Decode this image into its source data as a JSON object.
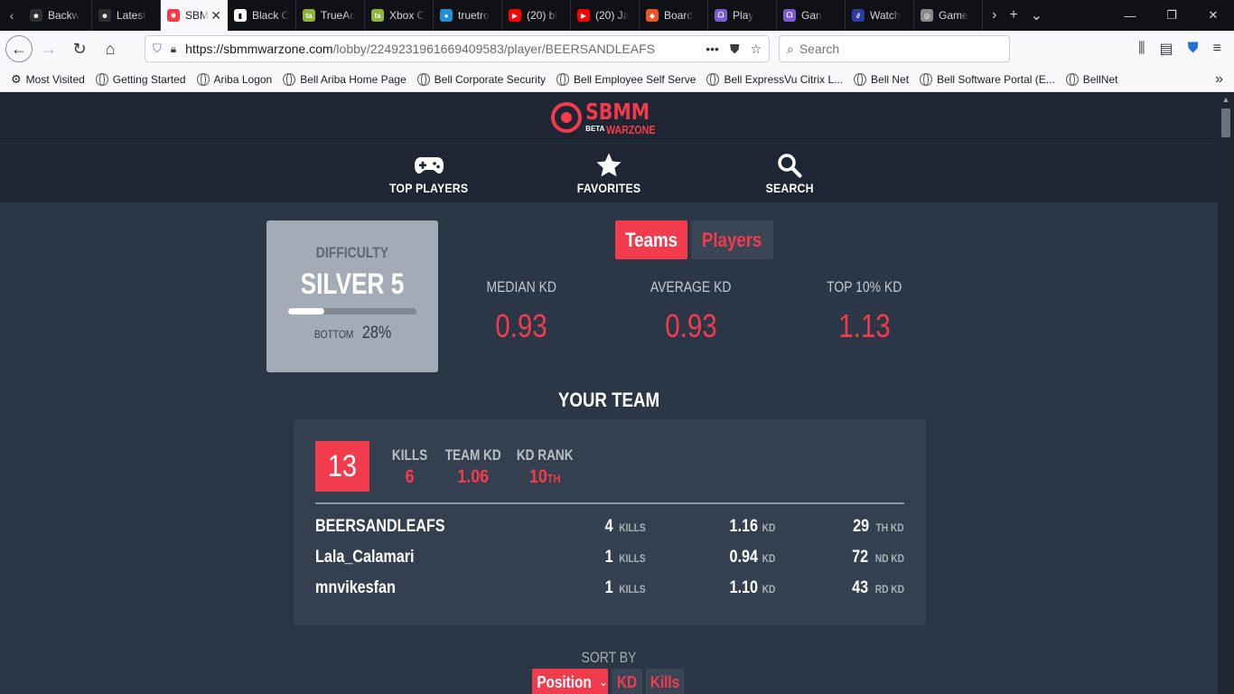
{
  "browser": {
    "tabs": [
      {
        "label": "Backw",
        "color": "#2f2f2f",
        "glyph": "☻"
      },
      {
        "label": "Latest",
        "color": "#2f2f2f",
        "glyph": "☻"
      },
      {
        "label": "SBM",
        "color": "#f23b4c",
        "glyph": "✺",
        "active": true
      },
      {
        "label": "Black C",
        "color": "#ffffff",
        "glyph": "▮"
      },
      {
        "label": "TrueAc",
        "color": "#8db33a",
        "glyph": "ta"
      },
      {
        "label": "Xbox C",
        "color": "#8db33a",
        "glyph": "ta"
      },
      {
        "label": "truetro",
        "color": "#1f8fd6",
        "glyph": "●"
      },
      {
        "label": "(20) bl",
        "color": "#ff0000",
        "glyph": "▶"
      },
      {
        "label": "(20) Ja",
        "color": "#ff0000",
        "glyph": "▶"
      },
      {
        "label": "Board",
        "color": "#e8562a",
        "glyph": "◆"
      },
      {
        "label": "Play",
        "color": "#7b5cd6",
        "glyph": "ᗝ"
      },
      {
        "label": "Gan",
        "color": "#7b5cd6",
        "glyph": "ᗝ"
      },
      {
        "label": "Watch",
        "color": "#2c3aa8",
        "glyph": "∂"
      },
      {
        "label": "Game",
        "color": "#8a8a8a",
        "glyph": "◎"
      }
    ],
    "url_prefix": "https://sbmmwarzone.com",
    "url_path": "/lobby/2249231961669409583/player/BEERSANDLEAFS",
    "search_placeholder": "Search",
    "bookmarks": [
      "Most Visited",
      "Getting Started",
      "Ariba Logon",
      "Bell Ariba Home Page",
      "Bell Corporate Security",
      "Bell Employee Self Serve",
      "Bell ExpressVu Citrix L...",
      "Bell Net",
      "Bell Software Portal (E...",
      "BellNet"
    ]
  },
  "site": {
    "logo_top": "SBMM",
    "logo_beta": "BETA",
    "logo_sub": "WARZONE",
    "accent": "#f23b4c",
    "nav": [
      {
        "label": "TOP PLAYERS",
        "icon": "gamepad-icon"
      },
      {
        "label": "FAVORITES",
        "icon": "star-icon"
      },
      {
        "label": "SEARCH",
        "icon": "search-icon"
      }
    ]
  },
  "difficulty": {
    "label": "DIFFICULTY",
    "value": "SILVER 5",
    "progress_percent": 28,
    "bottom_label": "BOTTOM",
    "bottom_value": "28%"
  },
  "toggle": {
    "teams": "Teams",
    "players": "Players",
    "selected": "Teams"
  },
  "stats": [
    {
      "label": "MEDIAN KD",
      "value": "0.93"
    },
    {
      "label": "AVERAGE KD",
      "value": "0.93"
    },
    {
      "label": "TOP 10% KD",
      "value": "1.13"
    }
  ],
  "team": {
    "heading": "YOUR TEAM",
    "place": "13",
    "kills_label": "KILLS",
    "kills_value": "6",
    "team_kd_label": "TEAM KD",
    "team_kd_value": "1.06",
    "kd_rank_label": "KD RANK",
    "kd_rank_value": "10",
    "kd_rank_suffix": "TH",
    "players": [
      {
        "name": "BEERSANDLEAFS",
        "kills": "4",
        "kills_unit": "KILLS",
        "kd": "1.16",
        "kd_unit": "KD",
        "rank": "29",
        "rank_unit": "TH KD"
      },
      {
        "name": "Lala_Calamari",
        "kills": "1",
        "kills_unit": "KILLS",
        "kd": "0.94",
        "kd_unit": "KD",
        "rank": "72",
        "rank_unit": "ND KD"
      },
      {
        "name": "mnvikesfan",
        "kills": "1",
        "kills_unit": "KILLS",
        "kd": "1.10",
        "kd_unit": "KD",
        "rank": "43",
        "rank_unit": "RD KD"
      }
    ]
  },
  "sort": {
    "label": "SORT BY",
    "options": [
      "Position",
      "KD",
      "Kills"
    ],
    "selected": "Position"
  }
}
